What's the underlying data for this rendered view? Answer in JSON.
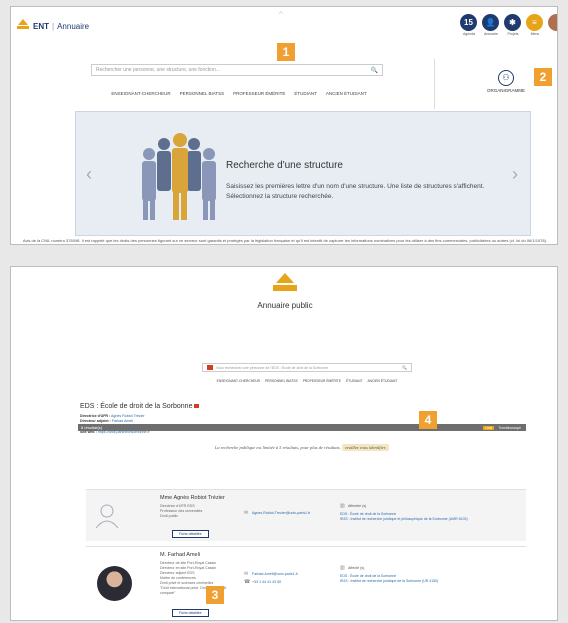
{
  "header": {
    "ent": "ENT",
    "sep": "|",
    "annuaire": "Annuaire"
  },
  "top_icons": [
    {
      "name": "agenda",
      "label": "Agenda",
      "text": "15",
      "color": "#1f3a6e"
    },
    {
      "name": "annuaire",
      "label": "Annuaire",
      "text": "",
      "color": "#1f3a6e"
    },
    {
      "name": "projets",
      "label": "Projets",
      "text": "",
      "color": "#1f3a6e"
    },
    {
      "name": "menu",
      "label": "Menu",
      "text": "≡",
      "color": "#e8a418"
    }
  ],
  "search1": {
    "placeholder": "Rechercher une personne, une structure, une fonction..."
  },
  "nav": [
    "ENSEIGNANT-CHERCHEUR",
    "PERSONNEL BIATSS",
    "PROFESSEUR ÉMÉRITE",
    "ÉTUDIANT",
    "ANCIEN ÉTUDIANT"
  ],
  "organigramme": "ORGANIGRAMME",
  "carousel": {
    "title": "Recherche d'une structure",
    "text": "Saisissez les premières lettre d'un nom d'une structure. Une liste de structures s'affichent. Sélectionnez la structure recherchée.",
    "prev": "‹",
    "next": "›"
  },
  "footer1": "Avis de la CNIL numéro 376098. Il est rappelé que les droits des personnes figurant sur ce serveur sont garantis et protégés par la législation française et qu'il est interdit de capturer les informations nominatives pour les utiliser à des fins commerciales, publicitaires ou autres (cf. loi du 06/1/1978).",
  "badges": [
    "1",
    "2",
    "3",
    "4"
  ],
  "p2": {
    "title": "Annuaire public",
    "search_value": "Vous recherchez une personne de l'EDS : École de droit de la Sorbonne",
    "nav": [
      "ENSEIGNANT-CHERCHEUR",
      "PERSONNEL BIATSS",
      "PROFESSEUR ÉMÉRITE",
      "ÉTUDIANT",
      "ANCIEN ÉTUDIANT"
    ],
    "struct_title": "EDS : École de droit de la Sorbonne",
    "struct_lines": [
      {
        "k": "Directrice d'UFR :",
        "v": "Agnès Robiot Trézier"
      },
      {
        "k": "Directeur adjoint :",
        "v": "Farhad Ameli"
      },
      {
        "k": "Responsable administratif général :",
        "v": "Pierre Mutard"
      },
      {
        "k": "Site web :",
        "v": "https://droit.pantheonsorbonne.fr"
      }
    ],
    "results": "8 résultat(s)",
    "export": "Liste",
    "export2": "Trombinoscope",
    "public_note": "La recherche publique est limitée à 5 résultats, pour plus de résultats,",
    "public_link": "veuillez vous identifier.",
    "people": [
      {
        "name": "Mme Agnès Robiot Trézier",
        "lines": [
          "Directrice d'UFR EDS",
          "Professeur des universités",
          "Droit public"
        ],
        "email": "Agnes.Robiot-Trezier@univ-paris1.fr",
        "phone": "",
        "aff_title": "Affectée (s)",
        "aff": [
          "EDS : École de droit de la Sorbonne",
          "IRJS : Institut de recherche juridique et philosophique de la Sorbonne (UMR 8103)"
        ],
        "btn": "Fiche détaillée"
      },
      {
        "name": "M. Farhad Ameli",
        "lines": [
          "Directeur de site Port-Royal Cassin",
          "Directeur en site Port-Royal Cassin",
          "Directeur adjoint EDS",
          "Maître de conférences",
          "Droit privé et sciences criminelles",
          "\"Droit international privé, Droit privé, Droit comparé\""
        ],
        "email": "Farhad.Ameli@univ-paris1.fr",
        "phone": "+33 1 44 41 43 50",
        "aff_title": "Affecté (s)",
        "aff": [
          "EDS : École de droit de la Sorbonne",
          "IRJS : Institut de recherche juridique de la Sorbonne (UR 4150)"
        ],
        "btn": "Fiche détaillée"
      }
    ]
  }
}
